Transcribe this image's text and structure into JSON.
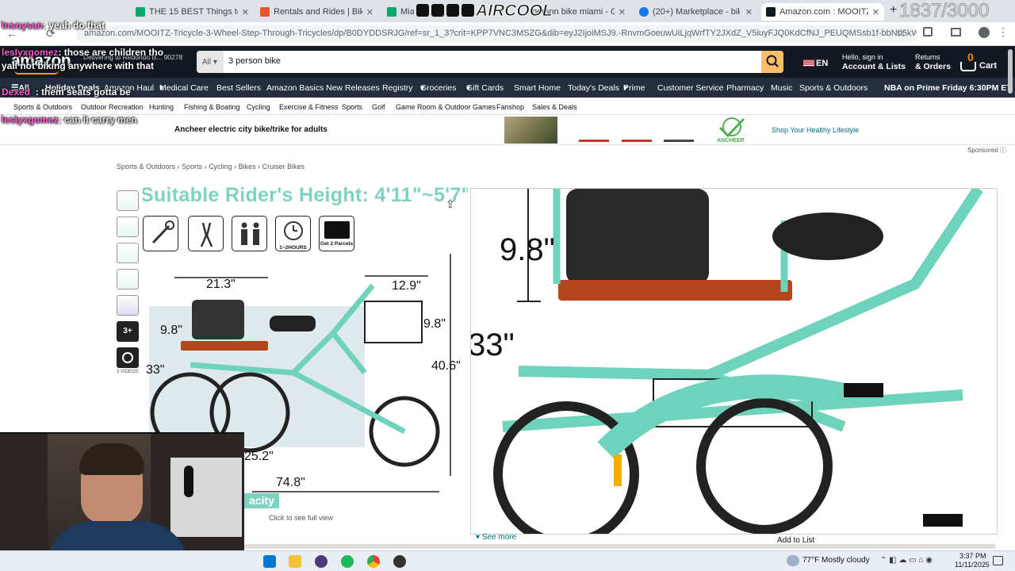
{
  "browser": {
    "tabs": [
      {
        "label": "THE 15 BEST Things to Do in M",
        "color": "#00aa6c"
      },
      {
        "label": "Rentals and Rides | Bike Rentals",
        "color": "#e4572e"
      },
      {
        "label": "Miami",
        "color": "#00aa6c"
      },
      {
        "label": "person bike miami - Google S",
        "color": "#4285f4"
      },
      {
        "label": "(20+) Marketplace - bike friday",
        "color": "#1877f2"
      },
      {
        "label": "Amazon.com : MOOITZ Adult T",
        "color": "#131921"
      }
    ],
    "url": "amazon.com/MOOITZ-Tricycle-3-Wheel-Step-Through-Tricycles/dp/B0DYDDSRJG/ref=sr_1_3?crit=KPP7VNC3MSZG&dib=eyJ2IjoiMSJ9.-RnvmGoeuwUiLjqWrfTY2JXdZ_V5iuyFJQ0KdCfNJ_PEUQMSsb1f-bbNb5kWvLI5zropJcHz7Bni9LM8A1aJ2Ik0Du..."
  },
  "overlay": {
    "counter": "1837/3000",
    "brand": "AIRCOOL",
    "chat": [
      {
        "user": "Insoysan",
        "msg": "yeah do that",
        "color": "#ff5ad2"
      },
      {
        "user": "lesIyxgomez",
        "msg": "those are children tho",
        "color": "#ff5ad2"
      },
      {
        "user": "",
        "msg": "yall not biking anywhere with that",
        "color": "#ffffff"
      },
      {
        "user": "Dexed_",
        "msg": "them seats gotta be",
        "color": "#ff5ad2"
      },
      {
        "user": "lesIyxgomez",
        "msg": "can it carry men",
        "color": "#ff5ad2"
      }
    ]
  },
  "amazon": {
    "logo": "amazon",
    "deliver": "Delivering to Redondo B... 90278",
    "search_cat": "All",
    "search_query": "3 person bike",
    "lang": "EN",
    "account_top": "Hello, sign in",
    "account": "Account & Lists",
    "returns_top": "Returns",
    "returns": "& Orders",
    "cart_count": "0",
    "cart": "Cart",
    "nav": [
      "All",
      "Holiday Deals",
      "Amazon Haul",
      "Medical Care",
      "Best Sellers",
      "Amazon Basics",
      "New Releases",
      "Registry",
      "Groceries",
      "Gift Cards",
      "Smart Home",
      "Today's Deals",
      "Prime",
      "Customer Service",
      "Pharmacy",
      "Music",
      "Sports & Outdoors"
    ],
    "nav_promo": "NBA on Prime Friday 6:30PM ET",
    "subnav": [
      "Sports & Outdoors",
      "Outdoor Recreation",
      "Hunting",
      "Fishing & Boating",
      "Cycling",
      "Exercise & Fitness",
      "Sports",
      "Golf",
      "Game Room & Outdoor Games",
      "Fanshop",
      "Sales & Deals"
    ],
    "banner_text": "Ancheer electric city bike/trike for adults",
    "banner_brand": "ANCHEER",
    "banner_cta": "Shop Your Healthy Lifestyle",
    "sponsored": "Sponsored",
    "breadcrumb": [
      "Sports & Outdoors",
      "Sports",
      "Cycling",
      "Bikes",
      "Cruiser Bikes"
    ],
    "thumb_more": "3+",
    "thumb_videos": "3 VIDEOS",
    "main_heading": "Suitable Rider's Height: 4'11\"~5'7\"",
    "feature_icons": [
      "wrench-icon",
      "pliers-icon",
      "riders-icon",
      "1~2HOURS",
      "Get 2 Parcels"
    ],
    "hours_label": "1~2HOURS",
    "parcels_label": "Get 2 Parcels",
    "dims": {
      "a": "21.3\"",
      "b": "12.9\"",
      "c": "9.8\"",
      "d": "9.8\"",
      "e": "33\"",
      "f": "40.6\"",
      "g": "25.2\"",
      "h": "74.8\""
    },
    "zoom_dims": {
      "a": "9.8\"",
      "b": "33\""
    },
    "capacity_label": "acity",
    "click_full": "Click to see full view",
    "see_more": "See more",
    "add_list": "Add to List"
  },
  "taskbar": {
    "weather": "77°F  Mostly cloudy",
    "time": "3:37 PM",
    "date": "11/11/2025"
  }
}
